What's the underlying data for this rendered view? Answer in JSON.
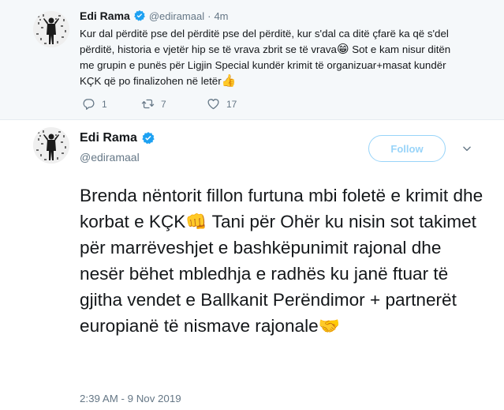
{
  "top_tweet": {
    "author_name": "Edi Rama",
    "handle": "@ediramaal",
    "separator": "·",
    "time": "4m",
    "text_lines": [
      "Kur dal përditë pse del përditë pse del përditë, kur s'dal ca ditë çfarë ka që s'del",
      "përditë, historia e vjetër hip se të vrava zbrit se të vrava",
      "me grupin e punës për Ligjin Special kundër krimit të organizuar+masat kundër",
      "KÇK që po finalizohen në letër"
    ],
    "line2_suffix": " Sot e kam nisur ditën",
    "emoji_grin": "😁",
    "emoji_thumbs": "👍",
    "replies": "1",
    "retweets": "7",
    "likes": "17"
  },
  "main_tweet": {
    "author_name": "Edi Rama",
    "handle": "@ediramaal",
    "follow_label": "Follow",
    "text_part1": "Brenda nëntorit fillon furtuna mbi foletë e krimit dhe korbat e KÇK",
    "emoji_fist": "👊",
    "text_part2": " Tani për Ohër ku nisin sot takimet për marrëveshjet e bashkëpunimit rajonal dhe nesër bëhet mbledhja e radhës ku janë ftuar të gjitha vendet e Ballkanit Perëndimor + partnerët europianë të nismave rajonale",
    "emoji_handshake": "🤝",
    "timestamp": "2:39 AM - 9 Nov 2019"
  },
  "icons": {
    "verified": "verified-badge-icon",
    "reply": "reply-icon",
    "retweet": "retweet-icon",
    "like": "heart-icon",
    "menu": "chevron-down-icon"
  },
  "colors": {
    "accent": "#1da1f2",
    "secondary_text": "#657786",
    "top_background": "#f5f8fa"
  }
}
